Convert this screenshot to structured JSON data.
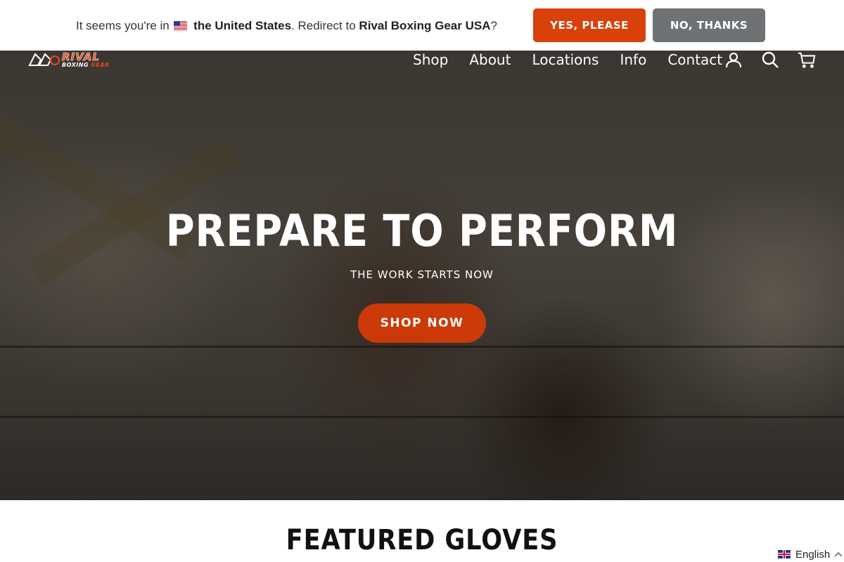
{
  "redirect_bar": {
    "prefix": "It seems you're in",
    "flag_icon": "us-flag-icon",
    "country": "the United States",
    "middle": ". Redirect to",
    "store": "Rival Boxing Gear USA",
    "suffix": "?",
    "yes_label": "YES, PLEASE",
    "no_label": "NO, THANKS"
  },
  "header": {
    "logo_main": "RIVAL",
    "logo_sub_1": "BOXING ",
    "logo_sub_2": "GEAR",
    "nav": [
      "Shop",
      "About",
      "Locations",
      "Info",
      "Contact"
    ],
    "icons": [
      "account-icon",
      "search-icon",
      "cart-icon"
    ]
  },
  "hero": {
    "title": "PREPARE TO PERFORM",
    "subtitle": "THE WORK STARTS NOW",
    "cta": "SHOP NOW"
  },
  "featured": {
    "title": "FEATURED GLOVES"
  },
  "language": {
    "current": "English"
  },
  "colors": {
    "accent": "#d8410b",
    "cta": "#cc3a0a",
    "secondary_button": "#6f7274"
  }
}
